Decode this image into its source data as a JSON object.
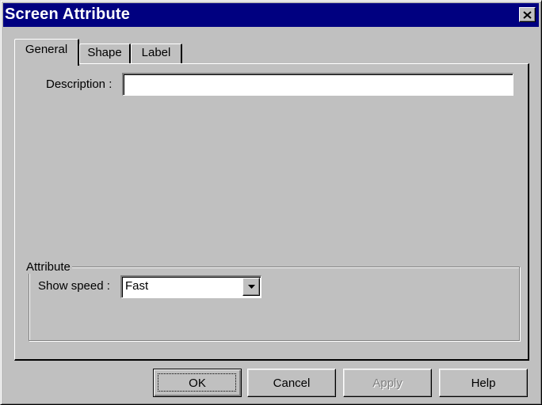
{
  "window": {
    "title": "Screen Attribute",
    "close_icon": "close-icon"
  },
  "tabs": [
    {
      "label": "General",
      "active": true
    },
    {
      "label": "Shape",
      "active": false
    },
    {
      "label": "Label",
      "active": false
    }
  ],
  "general": {
    "description_label": "Description :",
    "description_value": "",
    "attribute_group_label": "Attribute",
    "show_speed_label": "Show speed :",
    "show_speed_value": "Fast"
  },
  "buttons": {
    "ok": "OK",
    "cancel": "Cancel",
    "apply": "Apply",
    "help": "Help"
  },
  "colors": {
    "titlebar": "#000080",
    "face": "#c0c0c0"
  }
}
